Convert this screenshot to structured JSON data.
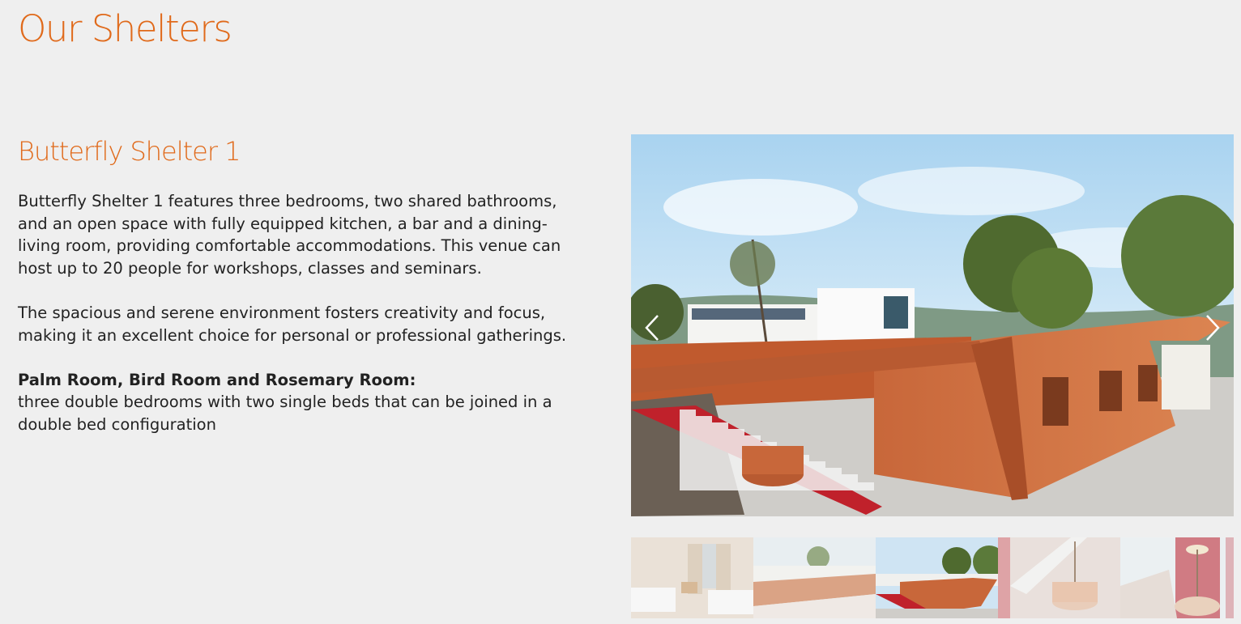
{
  "page": {
    "title": "Our Shelters"
  },
  "shelter": {
    "name": "Butterfly Shelter 1",
    "paragraph1": "Butterfly Shelter 1 features three bedrooms, two shared bathrooms, and an open space with fully equipped kitchen, a bar and a dining-living room,  providing comfortable accommodations. This venue can host up to 20 people for workshops, classes and seminars.",
    "paragraph2": "The spacious and serene environment fosters creativity and focus, making it an excellent choice for personal or professional gatherings.",
    "rooms_title": "Palm Room, Bird Room and Rosemary Room:",
    "rooms_text": "three double bedrooms with two single beds that can be joined in a double bed configuration"
  },
  "gallery": {
    "prev_icon": "chevron-left-icon",
    "next_icon": "chevron-right-icon",
    "thumbnails": [
      {
        "subject": "bedroom"
      },
      {
        "subject": "shelter exterior"
      },
      {
        "subject": "shelter exterior with stairs",
        "active": true
      },
      {
        "subject": "red stairs and planter"
      },
      {
        "subject": "planter with tree"
      }
    ]
  },
  "colors": {
    "accent": "#e06a1b",
    "background": "#efefef",
    "text": "#222222"
  }
}
